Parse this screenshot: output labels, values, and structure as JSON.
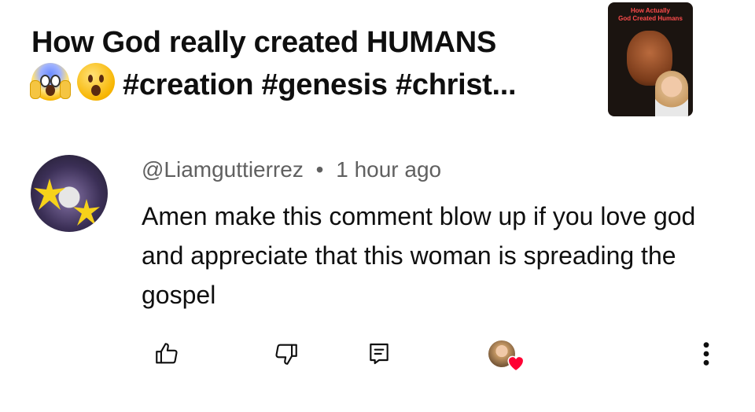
{
  "video": {
    "title_line1": "How God really created HUMANS",
    "title_line2_tags": "#creation #genesis #christ...",
    "emojis": [
      "face-screaming-in-fear",
      "hushed-face"
    ],
    "thumbnail": {
      "caption_line1": "How Actually",
      "caption_line2": "God Created Humans"
    }
  },
  "comment": {
    "author": "@Liamguttierrez",
    "separator": "•",
    "time": "1 hour ago",
    "text": "Amen make this comment blow up if you love god and appreciate that this woman is spreading the gospel"
  },
  "actions": {
    "icons": [
      "like-icon",
      "dislike-icon",
      "reply-icon",
      "creator-heart-icon",
      "more-vertical-icon"
    ],
    "heart_color": "#ff0033"
  }
}
